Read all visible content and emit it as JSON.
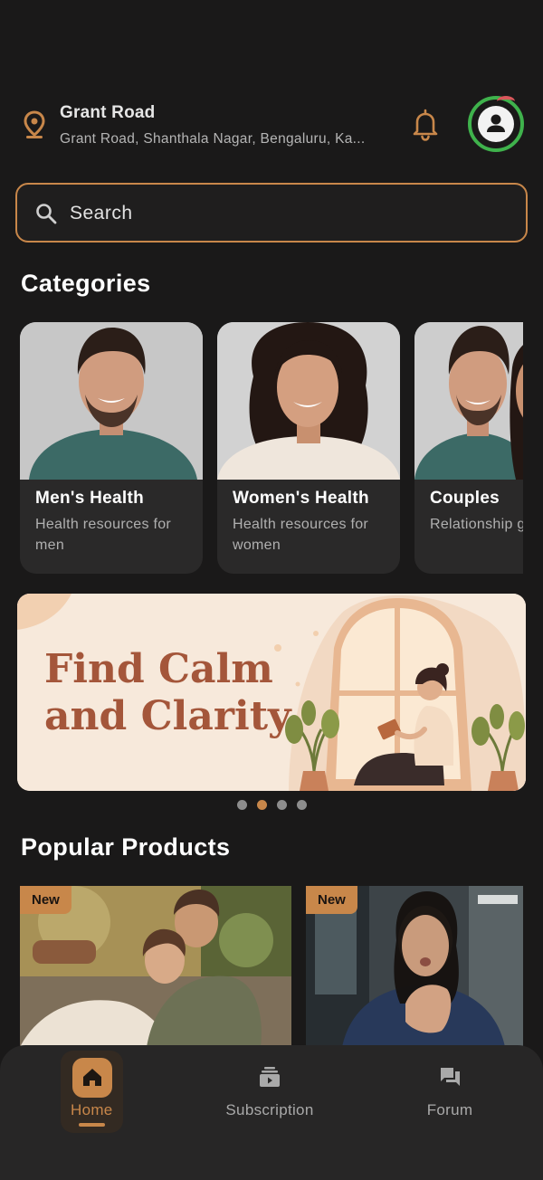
{
  "header": {
    "location_title": "Grant Road",
    "location_address": "Grant Road, Shanthala Nagar, Bengaluru, Ka...",
    "icons": [
      "location-pin-icon",
      "bell-icon",
      "profile-avatar-icon"
    ]
  },
  "search": {
    "placeholder": "Search"
  },
  "categories": {
    "title": "Categories",
    "items": [
      {
        "name": "Men's Health",
        "desc": "Health resources for men"
      },
      {
        "name": "Women's Health",
        "desc": "Health resources for women"
      },
      {
        "name": "Couples",
        "desc": "Relationship guidance"
      }
    ]
  },
  "banner": {
    "line1": "Find Calm",
    "line2": "and Clarity",
    "page_count": 4,
    "active_index": 1
  },
  "popular": {
    "title": "Popular Products",
    "items": [
      {
        "badge": "New"
      },
      {
        "badge": "New"
      }
    ]
  },
  "nav": {
    "items": [
      {
        "label": "Home",
        "active": true,
        "icon": "home-icon"
      },
      {
        "label": "Subscription",
        "active": false,
        "icon": "subscription-icon"
      },
      {
        "label": "Forum",
        "active": false,
        "icon": "forum-icon"
      }
    ]
  },
  "colors": {
    "accent": "#c8874a",
    "background": "#1a1919",
    "card": "#2a2929",
    "avatar_ring": "#3fb24c"
  }
}
